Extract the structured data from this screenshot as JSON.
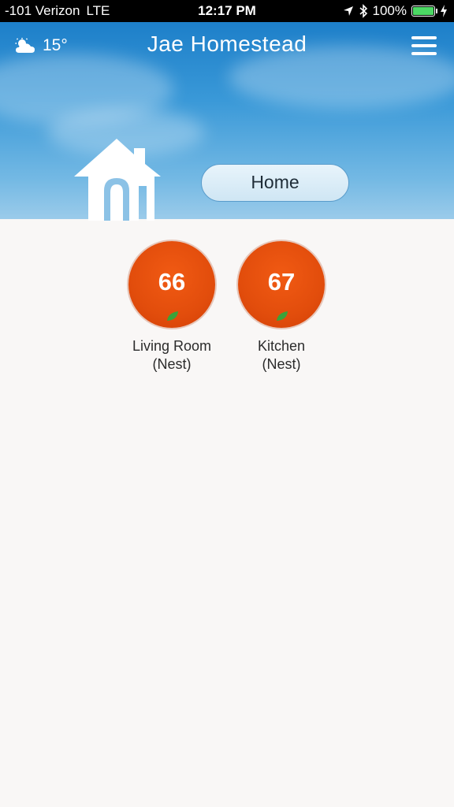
{
  "status_bar": {
    "carrier": "-101 Verizon",
    "network": "LTE",
    "time": "12:17 PM",
    "battery": "100%",
    "battery_color": "#4cd964"
  },
  "header": {
    "weather_icon": "partly-cloudy-icon",
    "temperature": "15°",
    "title": "Jae Homestead",
    "menu_icon": "hamburger-menu-icon"
  },
  "mode": {
    "label": "Home"
  },
  "thermostats": [
    {
      "temp": "66",
      "name": "Living Room",
      "type": "(Nest)",
      "color": "#e24d0c",
      "leaf_color": "#3aa33a"
    },
    {
      "temp": "67",
      "name": "Kitchen",
      "type": "(Nest)",
      "color": "#e24d0c",
      "leaf_color": "#3aa33a"
    }
  ]
}
